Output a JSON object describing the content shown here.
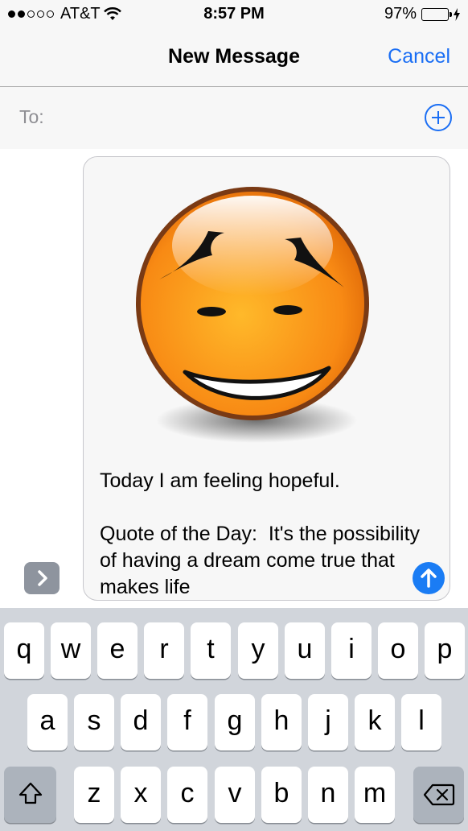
{
  "status_bar": {
    "carrier": "AT&T",
    "time": "8:57 PM",
    "battery": "97%",
    "battery_level": 0.97,
    "signal_bars": 2,
    "signal_total": 5
  },
  "nav": {
    "title": "New Message",
    "cancel_label": "Cancel"
  },
  "recipient": {
    "to_label": "To:"
  },
  "message": {
    "text": "Today I am feeling hopeful.\n\nQuote of the Day:  It's the possibility of having a dream come true that makes life"
  },
  "colors": {
    "accent": "#1a6ef4",
    "send": "#1a7cf4",
    "battery": "#4cd964"
  },
  "keyboard": {
    "row1": [
      "q",
      "w",
      "e",
      "r",
      "t",
      "y",
      "u",
      "i",
      "o",
      "p"
    ],
    "row2": [
      "a",
      "s",
      "d",
      "f",
      "g",
      "h",
      "j",
      "k",
      "l"
    ],
    "row3": [
      "z",
      "x",
      "c",
      "v",
      "b",
      "n",
      "m"
    ],
    "shift_icon": "shift-icon",
    "delete_icon": "delete-icon"
  }
}
